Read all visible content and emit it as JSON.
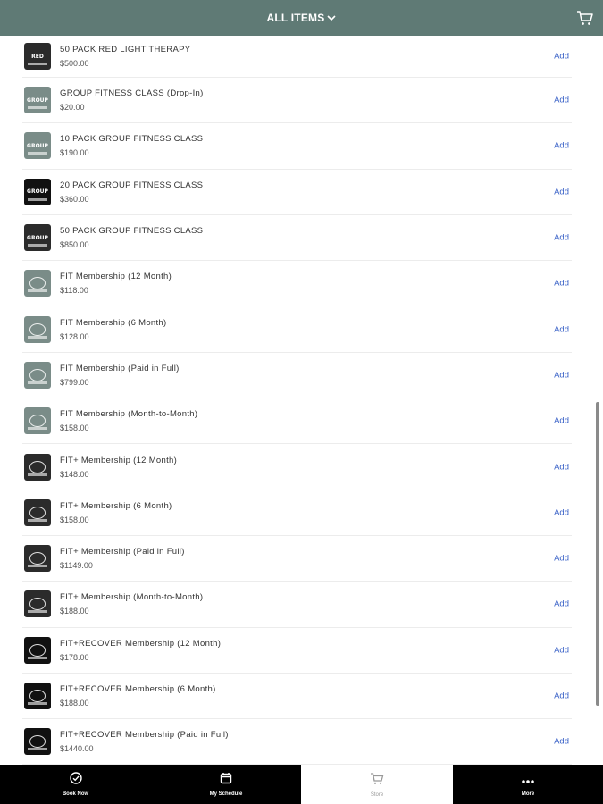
{
  "header": {
    "title": "ALL ITEMS",
    "chevron_icon": "chevron-down-icon",
    "cart_icon": "cart-icon"
  },
  "items": [
    {
      "name": "50 PACK RED LIGHT THERAPY",
      "price": "$500.00",
      "add": "Add",
      "thumb_style": "dark",
      "thumb_word": "RED"
    },
    {
      "name": "GROUP FITNESS CLASS (Drop-In)",
      "price": "$20.00",
      "add": "Add",
      "thumb_style": "gray",
      "thumb_word": "GROUP"
    },
    {
      "name": "10 PACK GROUP FITNESS CLASS",
      "price": "$190.00",
      "add": "Add",
      "thumb_style": "gray",
      "thumb_word": "GROUP"
    },
    {
      "name": "20 PACK GROUP FITNESS CLASS",
      "price": "$360.00",
      "add": "Add",
      "thumb_style": "black",
      "thumb_word": "GROUP"
    },
    {
      "name": "50 PACK GROUP FITNESS CLASS",
      "price": "$850.00",
      "add": "Add",
      "thumb_style": "dark",
      "thumb_word": "GROUP"
    },
    {
      "name": "FIT Membership (12 Month)",
      "price": "$118.00",
      "add": "Add",
      "thumb_style": "gray",
      "thumb_word": ""
    },
    {
      "name": "FIT Membership (6 Month)",
      "price": "$128.00",
      "add": "Add",
      "thumb_style": "gray",
      "thumb_word": ""
    },
    {
      "name": "FIT Membership (Paid in Full)",
      "price": "$799.00",
      "add": "Add",
      "thumb_style": "gray",
      "thumb_word": ""
    },
    {
      "name": "FIT Membership (Month-to-Month)",
      "price": "$158.00",
      "add": "Add",
      "thumb_style": "gray",
      "thumb_word": ""
    },
    {
      "name": "FIT+ Membership (12 Month)",
      "price": "$148.00",
      "add": "Add",
      "thumb_style": "dark",
      "thumb_word": ""
    },
    {
      "name": "FIT+ Membership (6 Month)",
      "price": "$158.00",
      "add": "Add",
      "thumb_style": "dark",
      "thumb_word": ""
    },
    {
      "name": "FIT+ Membership (Paid in Full)",
      "price": "$1149.00",
      "add": "Add",
      "thumb_style": "dark",
      "thumb_word": ""
    },
    {
      "name": "FIT+ Membership (Month-to-Month)",
      "price": "$188.00",
      "add": "Add",
      "thumb_style": "dark",
      "thumb_word": ""
    },
    {
      "name": "FIT+RECOVER Membership (12 Month)",
      "price": "$178.00",
      "add": "Add",
      "thumb_style": "black",
      "thumb_word": ""
    },
    {
      "name": "FIT+RECOVER Membership (6 Month)",
      "price": "$188.00",
      "add": "Add",
      "thumb_style": "black",
      "thumb_word": ""
    },
    {
      "name": "FIT+RECOVER Membership (Paid in Full)",
      "price": "$1440.00",
      "add": "Add",
      "thumb_style": "black",
      "thumb_word": ""
    }
  ],
  "tabs": [
    {
      "label": "Book Now",
      "icon": "check-circle-icon",
      "style": "dark"
    },
    {
      "label": "My Schedule",
      "icon": "calendar-icon",
      "style": "dark"
    },
    {
      "label": "Store",
      "icon": "cart-icon",
      "style": "light"
    },
    {
      "label": "More",
      "icon": "more-dots-icon",
      "style": "dark"
    }
  ]
}
